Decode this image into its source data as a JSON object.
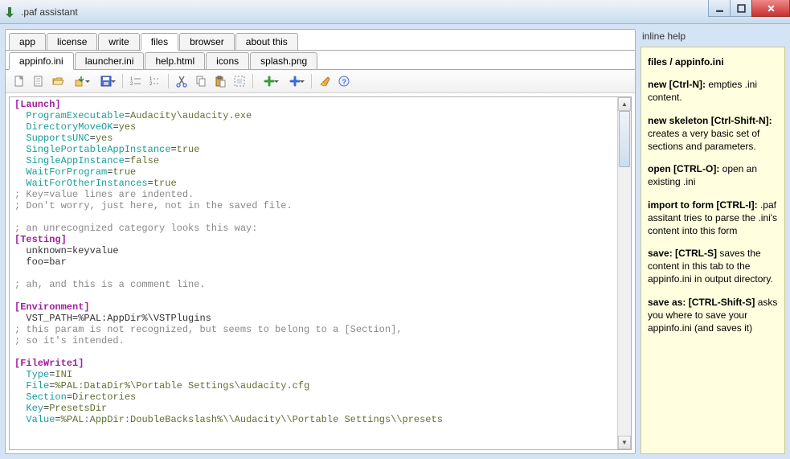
{
  "window": {
    "title": ".paf assistant"
  },
  "outerTabs": [
    {
      "label": "app"
    },
    {
      "label": "license"
    },
    {
      "label": "write"
    },
    {
      "label": "files",
      "active": true
    },
    {
      "label": "browser"
    },
    {
      "label": "about this"
    }
  ],
  "innerTabs": [
    {
      "label": "appinfo.ini",
      "active": true
    },
    {
      "label": "launcher.ini"
    },
    {
      "label": "help.html"
    },
    {
      "label": "icons"
    },
    {
      "label": "splash.png"
    }
  ],
  "toolbar": [
    {
      "name": "new-icon"
    },
    {
      "name": "new-skeleton-icon"
    },
    {
      "name": "open-icon"
    },
    {
      "name": "import-icon",
      "dd": true
    },
    {
      "name": "save-icon",
      "dd": true
    },
    {
      "sep": true
    },
    {
      "name": "number-list-icon"
    },
    {
      "name": "number-list2-icon"
    },
    {
      "sep": true
    },
    {
      "name": "cut-icon"
    },
    {
      "name": "copy-icon"
    },
    {
      "name": "paste-icon"
    },
    {
      "name": "select-all-icon"
    },
    {
      "sep": true
    },
    {
      "name": "add-green-icon",
      "dd": true
    },
    {
      "name": "add-blue-icon",
      "dd": true
    },
    {
      "sep": true
    },
    {
      "name": "highlight-icon"
    },
    {
      "name": "help-icon"
    }
  ],
  "editor": {
    "lines": [
      {
        "t": "sec",
        "v": "[Launch]"
      },
      {
        "t": "kv",
        "k": "ProgramExecutable",
        "v": "Audacity\\audacity.exe",
        "indent": 1
      },
      {
        "t": "kv",
        "k": "DirectoryMoveOK",
        "v": "yes",
        "indent": 1
      },
      {
        "t": "kv",
        "k": "SupportsUNC",
        "v": "yes",
        "indent": 1
      },
      {
        "t": "kv",
        "k": "SinglePortableAppInstance",
        "v": "true",
        "indent": 1
      },
      {
        "t": "kv",
        "k": "SingleAppInstance",
        "v": "false",
        "indent": 1
      },
      {
        "t": "kv",
        "k": "WaitForProgram",
        "v": "true",
        "indent": 1
      },
      {
        "t": "kv",
        "k": "WaitForOtherInstances",
        "v": "true",
        "indent": 1
      },
      {
        "t": "cmt",
        "v": "; Key=value lines are indented."
      },
      {
        "t": "cmt",
        "v": "; Don't worry, just here, not in the saved file."
      },
      {
        "t": "blank"
      },
      {
        "t": "cmt",
        "v": "; an unrecognized category looks this way:"
      },
      {
        "t": "sec",
        "v": "[Testing]"
      },
      {
        "t": "kvplain",
        "k": "unknown",
        "v": "keyvalue",
        "indent": 1
      },
      {
        "t": "kvplain",
        "k": "foo",
        "v": "bar",
        "indent": 1
      },
      {
        "t": "blank"
      },
      {
        "t": "cmt",
        "v": "; ah, and this is a comment line."
      },
      {
        "t": "blank"
      },
      {
        "t": "sec",
        "v": "[Environment]"
      },
      {
        "t": "kvplain",
        "k": "VST_PATH",
        "v": "%PAL:AppDir%\\VSTPlugins",
        "indent": 1
      },
      {
        "t": "cmt",
        "v": "; this param is not recognized, but seems to belong to a [Section],"
      },
      {
        "t": "cmt",
        "v": "; so it's intended."
      },
      {
        "t": "blank"
      },
      {
        "t": "sec",
        "v": "[FileWrite1]"
      },
      {
        "t": "kv",
        "k": "Type",
        "v": "INI",
        "indent": 1
      },
      {
        "t": "kv",
        "k": "File",
        "v": "%PAL:DataDir%\\Portable Settings\\audacity.cfg",
        "indent": 1
      },
      {
        "t": "kv",
        "k": "Section",
        "v": "Directories",
        "indent": 1
      },
      {
        "t": "kv",
        "k": "Key",
        "v": "PresetsDir",
        "indent": 1
      },
      {
        "t": "kv",
        "k": "Value",
        "v": "%PAL:AppDir:DoubleBackslash%\\\\Audacity\\\\Portable Settings\\\\presets",
        "indent": 1
      }
    ]
  },
  "help": {
    "title": "inline help",
    "path": "files / appinfo.ini",
    "items": [
      {
        "b": "new [Ctrl-N]:",
        "t": " empties .ini content."
      },
      {
        "b": "new skeleton [Ctrl-Shift-N]:",
        "t": " creates a very basic set of sections and parameters."
      },
      {
        "b": "open [CTRL-O]:",
        "t": " open an existing .ini"
      },
      {
        "b": "import to form [CTRL-I]:",
        "t": " .paf assitant tries to parse the .ini's content into this form"
      },
      {
        "b": "save: [CTRL-S]",
        "t": " saves the content in this tab to the appinfo.ini in output directory."
      },
      {
        "b": "save as: [CTRL-Shift-S]",
        "t": " asks you where to save your appinfo.ini (and saves it)"
      }
    ]
  }
}
